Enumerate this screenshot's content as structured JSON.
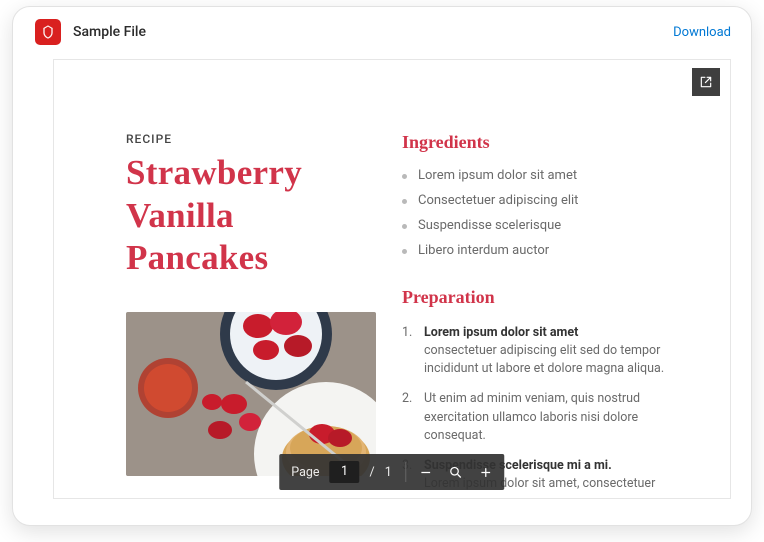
{
  "header": {
    "title": "Sample File",
    "download_label": "Download"
  },
  "document": {
    "overline": "RECIPE",
    "title": "Strawberry Vanilla Pancakes",
    "ingredients_heading": "Ingredients",
    "ingredients": [
      "Lorem ipsum dolor sit amet",
      "Consectetuer adipiscing elit",
      "Suspendisse scelerisque",
      "Libero interdum auctor"
    ],
    "preparation_heading": "Preparation",
    "steps": [
      {
        "title": "Lorem ipsum dolor sit amet",
        "body": "consectetuer adipiscing elit sed do tempor incididunt ut labore et dolore magna aliqua."
      },
      {
        "title": "",
        "body": "Ut enim ad minim veniam, quis nostrud exercitation ullamco laboris nisi dolore consequat."
      },
      {
        "title": "Suspendisse scelerisque mi a mi.",
        "body": "Lorem ipsum dolor sit amet, consectetuer"
      }
    ]
  },
  "toolbar": {
    "page_label": "Page",
    "current_page": "1",
    "total_pages": "1"
  }
}
